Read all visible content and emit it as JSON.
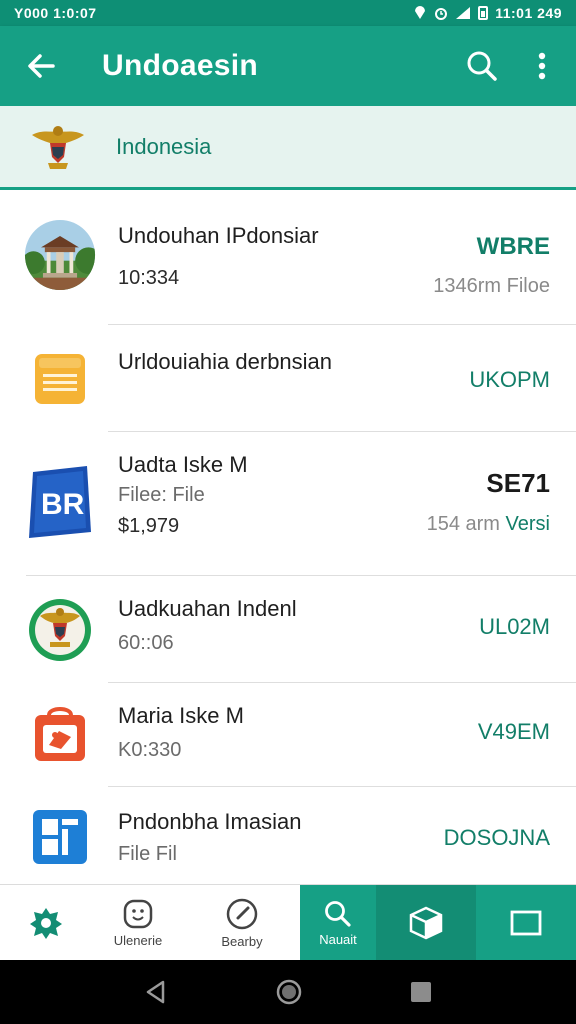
{
  "status_bar": {
    "left_text": "Y000 1:0:07",
    "time": "11:01 249"
  },
  "app_bar": {
    "title": "Undoaesin",
    "back_icon": "arrow-left-icon",
    "search_icon": "search-icon",
    "more_icon": "more-vert-icon"
  },
  "banner": {
    "country_name": "Indonesia",
    "emblem_icon": "garuda-emblem-icon"
  },
  "items": [
    {
      "icon": "pavilion-photo-icon",
      "title": "Undouhan IPdonsiar",
      "subtitle": "10:334",
      "right_tag": "WBRE",
      "right_sub": "1346rm Filoe"
    },
    {
      "icon": "document-icon",
      "title": "Urldouiahia derbnsian",
      "subtitle": "",
      "right_tag": "UKOPM",
      "right_sub": ""
    },
    {
      "icon": "br-app-icon",
      "title": "Uadta Iske M",
      "subtitle": "Filee: File",
      "tertiary": "$1,979",
      "right_tag": "SE71",
      "right_sub_a": "154 arm",
      "right_sub_b": "Versi"
    },
    {
      "icon": "garuda-emblem-icon",
      "title": "Uadkuahan Indenl",
      "subtitle": "60::06",
      "right_tag": "UL02M",
      "right_sub": ""
    },
    {
      "icon": "shopping-bag-icon",
      "title": "Maria Iske M",
      "subtitle": "K0:330",
      "right_tag": "V49EM",
      "right_sub": ""
    },
    {
      "icon": "grid-app-icon",
      "title": "Pndonbha Imasian",
      "subtitle": "File Fil",
      "right_tag": "DOSOJNA",
      "right_sub": ""
    }
  ],
  "bottom_nav": [
    {
      "icon": "puzzle-icon",
      "label": ""
    },
    {
      "icon": "smiley-icon",
      "label": "Ulenerie"
    },
    {
      "icon": "compass-icon",
      "label": "Bearby"
    },
    {
      "icon": "search-icon",
      "label": "Nauait",
      "active": true
    },
    {
      "icon": "cube-icon",
      "label": ""
    },
    {
      "icon": "square-icon",
      "label": ""
    }
  ],
  "colors": {
    "primary": "#16a085",
    "primary_dark": "#0e8f75",
    "accent_text": "#127e68"
  }
}
